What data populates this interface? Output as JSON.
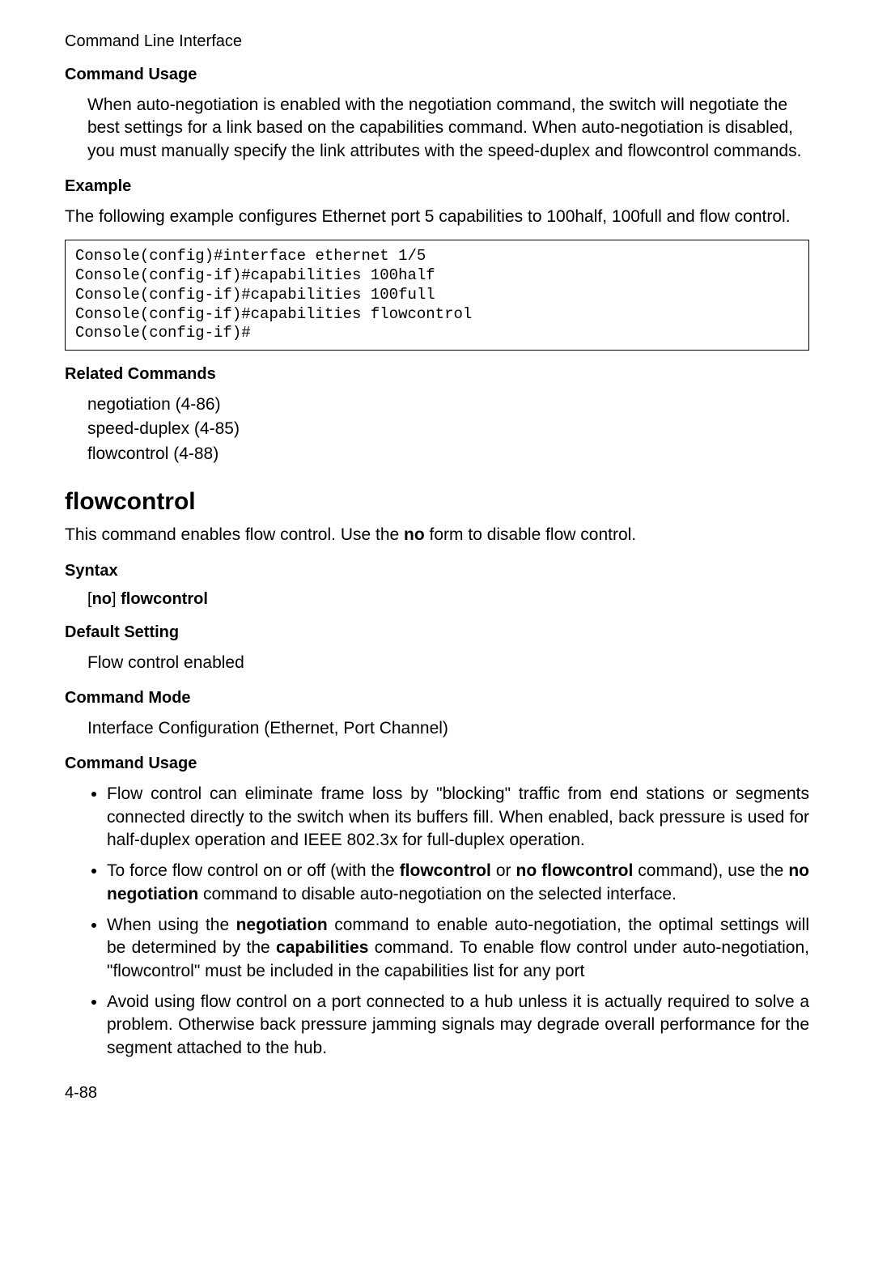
{
  "header": "Command Line Interface",
  "s1": {
    "h1": "Command Usage",
    "p1": "When auto-negotiation is enabled with the negotiation command, the switch will negotiate the best settings for a link based on the capabilities command. When auto-negotiation is disabled, you must manually specify the link attributes with the speed-duplex and flowcontrol commands.",
    "h2": "Example",
    "p2": "The following example configures Ethernet port 5 capabilities to 100half, 100full and flow control.",
    "code": "Console(config)#interface ethernet 1/5\nConsole(config-if)#capabilities 100half\nConsole(config-if)#capabilities 100full\nConsole(config-if)#capabilities flowcontrol\nConsole(config-if)#",
    "h3": "Related Commands",
    "rel1": "negotiation (4-86)",
    "rel2": "speed-duplex (4-85)",
    "rel3": "flowcontrol (4-88)"
  },
  "cmd": {
    "title": "flowcontrol",
    "intro_pre": "This command enables flow control. Use the ",
    "intro_bold": "no",
    "intro_post": " form to disable flow control.",
    "syntax_h": "Syntax",
    "syntax_open": "[",
    "syntax_no": "no",
    "syntax_close": "] ",
    "syntax_cmd": "flowcontrol",
    "default_h": "Default Setting",
    "default_v": "Flow control enabled",
    "mode_h": "Command Mode",
    "mode_v": "Interface Configuration (Ethernet, Port Channel)",
    "usage_h": "Command Usage",
    "b1": "Flow control can eliminate frame loss by \"blocking\" traffic from end stations or segments connected directly to the switch when its buffers fill. When enabled, back pressure is used for half-duplex operation and IEEE 802.3x for full-duplex operation.",
    "b2a": "To force flow control on or off (with the ",
    "b2b": "flowcontrol",
    "b2c": " or ",
    "b2d": "no flowcontrol",
    "b2e": " command), use the ",
    "b2f": "no negotiation",
    "b2g": " command to disable auto-negotiation on the selected interface.",
    "b3a": "When using the ",
    "b3b": "negotiation",
    "b3c": " command to enable auto-negotiation, the optimal settings will be determined by the ",
    "b3d": "capabilities",
    "b3e": " command. To enable flow control under auto-negotiation, \"flowcontrol\" must be included in the capabilities list for any port",
    "b4": "Avoid using flow control on a port connected to a hub unless it is actually required to solve a problem. Otherwise back pressure jamming signals may degrade overall performance for the segment attached to the hub."
  },
  "page_num": "4-88"
}
